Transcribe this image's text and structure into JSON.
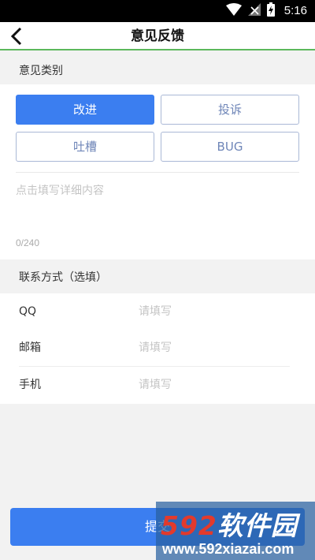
{
  "status_bar": {
    "time": "5:16"
  },
  "header": {
    "title": "意见反馈"
  },
  "feedback_type": {
    "label": "意见类别",
    "options": [
      "改进",
      "投诉",
      "吐槽",
      "BUG"
    ],
    "selected": "改进"
  },
  "detail": {
    "placeholder": "点击填写详细内容",
    "counter": "0/240"
  },
  "contact": {
    "label": "联系方式（选填）",
    "rows": [
      {
        "label": "QQ",
        "placeholder": "请填写"
      },
      {
        "label": "邮箱",
        "placeholder": "请填写"
      },
      {
        "label": "手机",
        "placeholder": "请填写"
      }
    ]
  },
  "submit": {
    "label": "提交"
  },
  "watermark": {
    "logo_num": "592",
    "logo_text": "软件园",
    "url": "www.592xiazai.com"
  },
  "colors": {
    "accent": "#3b7ef0",
    "header_rule": "#5cb85c",
    "status_bar": "#000000"
  }
}
